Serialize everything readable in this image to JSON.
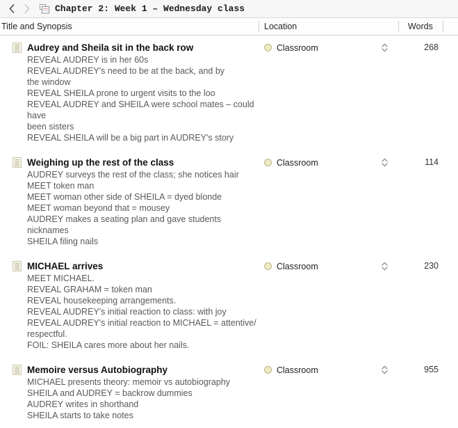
{
  "titlebar": {
    "back_label": "‹",
    "forward_label": "›",
    "icon_name": "document-stack-icon",
    "title": "Chapter 2: Week 1 – Wednesday class"
  },
  "columns": {
    "title": "Title and Synopsis",
    "location": "Location",
    "words": "Words"
  },
  "theme": {
    "titlebar_bg": "#f7f7f7",
    "header_bg": "#fdfdfd",
    "border": "#d2d2d2",
    "status_dot_fill": "#eeeac4",
    "status_dot_stroke": "#bdb684",
    "title_text": "#111111",
    "synopsis_text": "#595959"
  },
  "rows": [
    {
      "icon": "document-icon",
      "title": "Audrey and Sheila sit in the back row",
      "synopsis": "REVEAL AUDREY is in her 60s\nREVEAL AUDREY's need to be at the back, and by\nthe window\nREVEAL SHEILA prone to urgent visits to the loo\nREVEAL AUDREY and SHEILA were school mates – could have\nbeen sisters\nREVEAL SHEILA will be a big part in AUDREY's story",
      "location": "Classroom",
      "words": "268"
    },
    {
      "icon": "document-icon",
      "title": "Weighing up the rest of the class",
      "synopsis": "AUDREY surveys the rest of the class; she notices hair\nMEET token man\nMEET woman other side of SHEILA = dyed blonde\nMEET woman beyond that = mousey\nAUDREY makes a seating plan and gave students nicknames\nSHEILA filing nails",
      "location": "Classroom",
      "words": "114"
    },
    {
      "icon": "document-icon",
      "title": "MICHAEL arrives",
      "synopsis": "MEET MICHAEL.\nREVEAL GRAHAM = token man\nREVEAL housekeeping arrangements.\nREVEAL AUDREY's initial reaction to class: with joy\nREVEAL AUDREY's initial reaction to MICHAEL = attentive/\nrespectful.\nFOIL: SHEILA cares more about her nails.",
      "location": "Classroom",
      "words": "230"
    },
    {
      "icon": "document-icon",
      "title": "Memoire versus Autobiography",
      "synopsis": "MICHAEL presents theory: memoir vs autobiography\nSHEILA and AUDREY = backrow dummies\nAUDREY writes in shorthand\nSHEILA starts to take notes",
      "location": "Classroom",
      "words": "955"
    }
  ]
}
